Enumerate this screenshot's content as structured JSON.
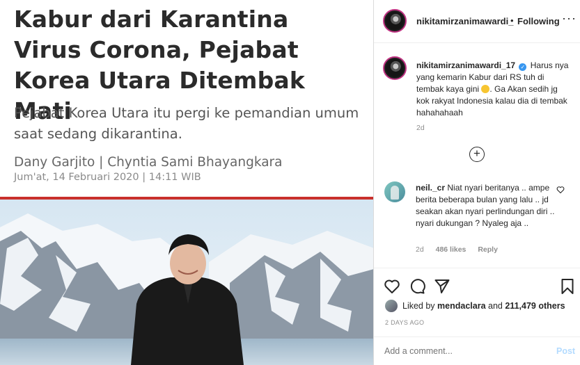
{
  "article": {
    "headline": "Kabur dari Karantina Virus Corona, Pejabat Korea Utara Ditembak Mati",
    "subhead": "Pejabat Korea Utara itu pergi ke pemandian umum saat sedang dikarantina.",
    "byline": "Dany Garjito | Chyntia Sami Bhayangkara",
    "date": "Jum'at, 14 Februari 2020 | 14:11 WIB"
  },
  "header": {
    "username": "nikitamirzanimawardi_",
    "separator": "•",
    "follow_status": "Following",
    "more": "···"
  },
  "caption": {
    "username": "nikitamirzanimawardi_17",
    "text_1": "Harus nya yang kemarin Kabur dari RS tuh di tembak kaya gini",
    "text_2": ". Ga Akan sedih jg kok rakyat Indonesia kalau dia di tembak hahahahaah",
    "time": "2d"
  },
  "load_more": "+",
  "comment": {
    "username": "neil._cr",
    "text": "Niat nyari beritanya .. ampe berita beberapa bulan yang lalu .. jd seakan akan nyari perlindungan diri .. nyari dukungan ? Nyaleg aja ..",
    "time": "2d",
    "likes": "486 likes",
    "reply": "Reply"
  },
  "likes": {
    "prefix": "Liked by",
    "user": "mendaclara",
    "middle": "and",
    "others": "211,479 others"
  },
  "post_date": "2 DAYS AGO",
  "add_comment": {
    "placeholder": "Add a comment...",
    "post": "Post"
  },
  "icons": {
    "verified": "verified-badge-icon",
    "like": "heart-icon",
    "comment": "comment-icon",
    "share": "paper-plane-icon",
    "save": "bookmark-icon"
  }
}
